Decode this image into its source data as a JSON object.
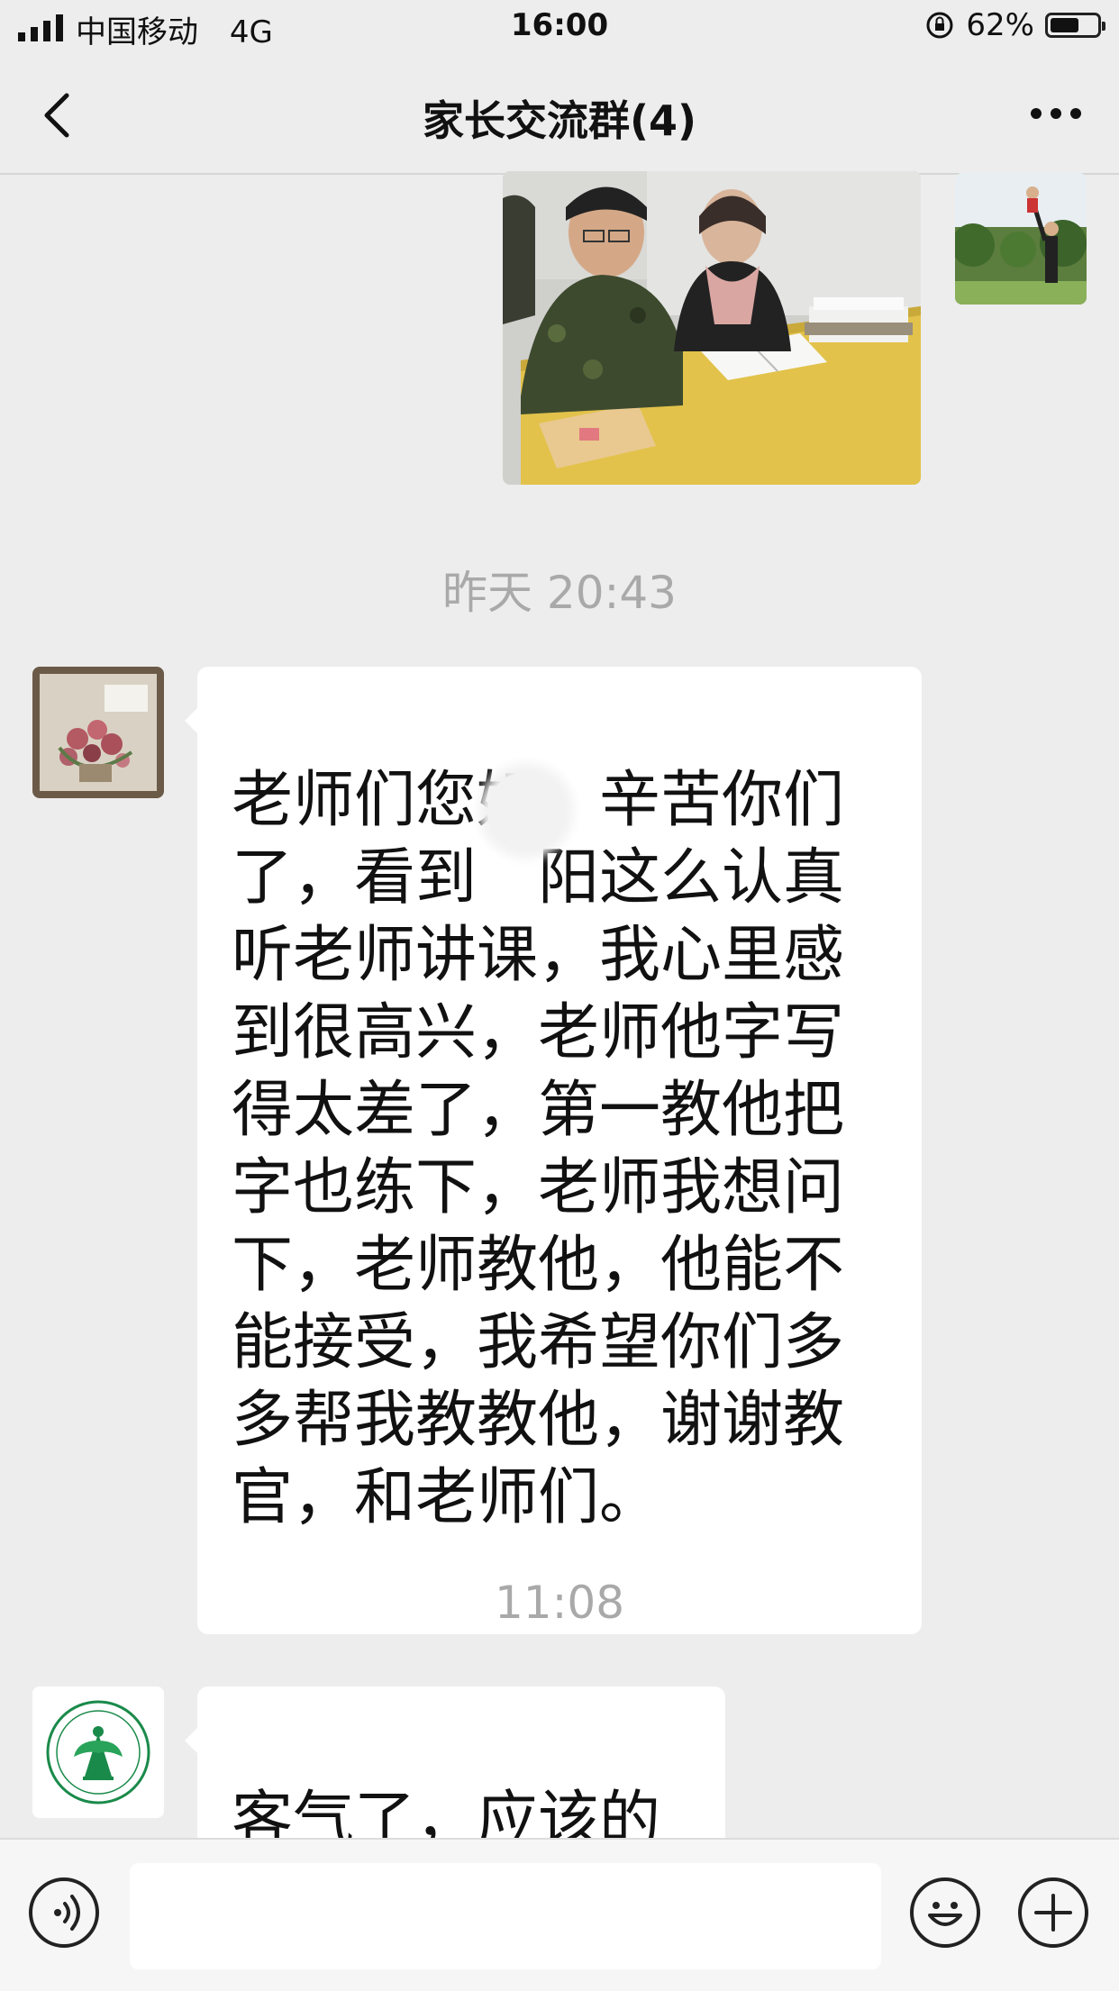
{
  "status_bar": {
    "carrier": "中国移动",
    "network": "4G",
    "time": "16:00",
    "battery_percent_text": "62%",
    "battery_level": 0.62
  },
  "nav": {
    "title": "家长交流群(4)",
    "back_icon": "chevron-left-icon",
    "more_icon": "more-dots-icon"
  },
  "messages": [
    {
      "type": "image",
      "description_icon": "photo"
    },
    {
      "type": "timestamp",
      "text": "昨天 20:43"
    },
    {
      "type": "text",
      "text": "老师们您好，辛苦你们\n了，看到　阳这么认真\n听老师讲课，我心里感\n到很高兴，老师他字写\n得太差了，第一教他把\n字也练下，老师我想问\n下，老师教他，他能不\n能接受，我希望你们多\n多帮我教教他，谢谢教\n官，和老师们。"
    },
    {
      "type": "timestamp",
      "text": "11:08"
    },
    {
      "type": "text",
      "text": "客气了，应该的"
    }
  ],
  "input_bar": {
    "voice_icon": "voice-icon",
    "emoji_icon": "emoji-icon",
    "plus_icon": "plus-icon",
    "input_value": ""
  },
  "colors": {
    "background": "#ededed",
    "bubble": "#ffffff",
    "timestamp": "#a9a9a9",
    "logo_green": "#1a8a4a"
  }
}
